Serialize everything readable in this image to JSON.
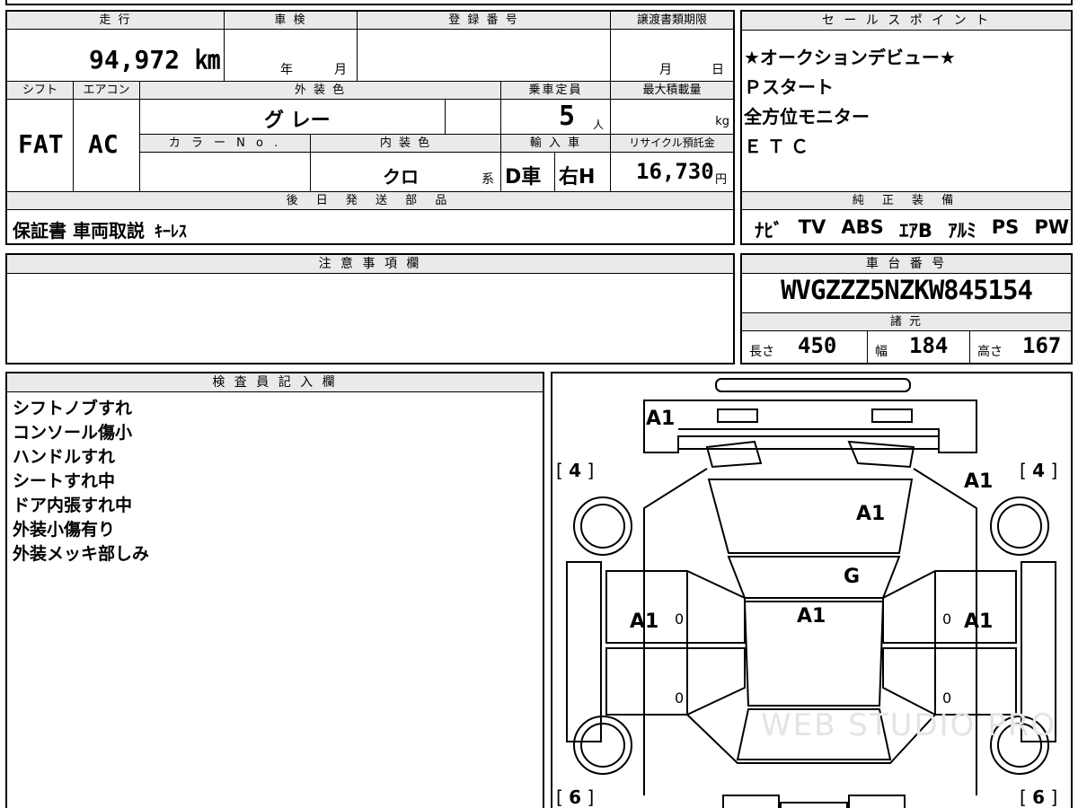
{
  "vehicle": {
    "mileage_label": "走 行",
    "mileage_value": "94,972 ㎞",
    "shaken_label": "車 検",
    "shaken_year": "年",
    "shaken_month": "月",
    "reg_label": "登 録 番 号",
    "transfer_label": "譲渡書類期限",
    "transfer_month": "月",
    "transfer_day": "日",
    "shift_label": "シフト",
    "shift_value": "FAT",
    "ac_label": "エアコン",
    "ac_value": "AC",
    "exterior_label": "外 装 色",
    "exterior_value": "グ レー",
    "color_no_label": "カ ラ ー N o .",
    "interior_label": "内 装 色",
    "interior_value": "クロ",
    "interior_suffix": "系",
    "capacity_label": "乗車定員",
    "capacity_value": "5",
    "capacity_unit": "人",
    "maxload_label": "最大積載量",
    "maxload_unit": "kg",
    "import_label": "輸 入 車",
    "import_type": "D車",
    "steering": "右H",
    "recycle_label": "リサイクル預託金",
    "recycle_value": "16,730",
    "recycle_unit": "円"
  },
  "sales_points": {
    "header": "セ ー ル ス ポ イ ン ト",
    "items": [
      "★オークションデビュー★",
      "Ｐスタート",
      "全方位モニター",
      "ＥＴＣ"
    ]
  },
  "shipping": {
    "header": "後 日 発 送 部 品",
    "value_main": "保証書 車両取説",
    "value_sub": "ｷｰﾚｽ"
  },
  "equipment": {
    "header": "純 正 装 備",
    "items": [
      "ﾅﾋﾞ",
      "TV",
      "ABS",
      "ｴｱB",
      "ｱﾙﾐ",
      "PS",
      "PW"
    ]
  },
  "caution": {
    "header": "注 意 事 項 欄"
  },
  "chassis": {
    "header": "車 台 番 号",
    "value": "WVGZZZ5NZKW845154",
    "specs_header": "諸 元",
    "length_label": "長さ",
    "length_value": "450",
    "width_label": "幅",
    "width_value": "184",
    "height_label": "高さ",
    "height_value": "167"
  },
  "inspector": {
    "header": "検 査 員 記 入 欄",
    "notes": [
      "シフトノブすれ",
      "コンソール傷小",
      "ハンドルすれ",
      "シートすれ中",
      "ドア内張すれ中",
      "外装小傷有り",
      "外装メッキ部しみ"
    ]
  },
  "diagram": {
    "marks": {
      "front_bumper": "A1",
      "hood_right": "A1",
      "hood_center": "A1",
      "windshield": "G",
      "roof": "A1",
      "front_left_door": "A1",
      "front_right_door": "A1",
      "front_right_fender": "A1"
    },
    "tire_fl": "4",
    "tire_fr": "4",
    "tire_rl": "6",
    "tire_rr": "6",
    "door_values": [
      "0",
      "0",
      "0",
      "0"
    ],
    "watermark": "WEB STUDIO PRO"
  },
  "colors": {
    "header_bg": "#eaeaea",
    "border": "#000000"
  }
}
